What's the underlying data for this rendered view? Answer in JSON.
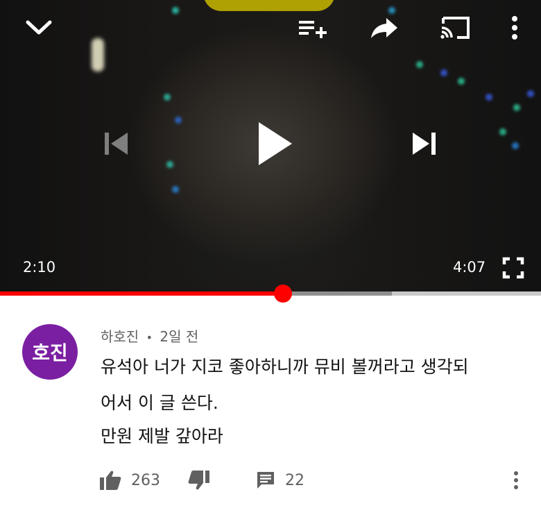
{
  "player": {
    "current_time": "2:10",
    "duration": "4:07",
    "progress": 0.523,
    "buffered": 0.724,
    "icons": {
      "collapse": "chevron-down-icon",
      "add_to_queue": "playlist-add-icon",
      "share": "share-icon",
      "cast": "cast-icon",
      "more": "more-vertical-icon",
      "previous": "skip-previous-icon",
      "play": "play-icon",
      "next": "skip-next-icon",
      "fullscreen": "fullscreen-icon"
    },
    "colors": {
      "progress": "#ff0000",
      "buffer": "#8f8f8f",
      "track": "#c9c9c9"
    }
  },
  "comment": {
    "avatar_text": "호진",
    "avatar_color": "#7b1fa2",
    "author": "하호진",
    "separator": "•",
    "time_ago": "2일 전",
    "lines": [
      "유석아 너가 지코 좋아하니까 뮤비 볼꺼라고 생각되",
      "어서 이 글 쓴다.",
      "만원 제발 갚아라"
    ],
    "likes": "263",
    "replies": "22"
  }
}
